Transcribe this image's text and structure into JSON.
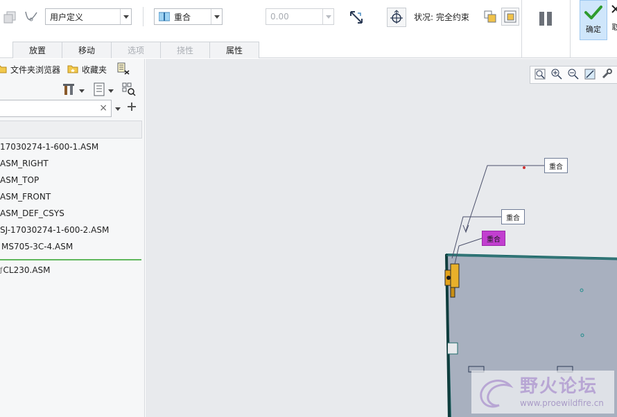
{
  "ribbon": {
    "tabs": [
      {
        "label": "放置"
      },
      {
        "label": "移动"
      },
      {
        "label": "选项"
      },
      {
        "label": "挠性"
      },
      {
        "label": "属性"
      }
    ],
    "constraint_set": {
      "value": "用户定义"
    },
    "constraint_type": {
      "value": "重合"
    },
    "offset": {
      "value": "0.00"
    },
    "status": "状况: 完全约束",
    "ok_label": "确定",
    "cancel_label": "取"
  },
  "left_panel": {
    "header": {
      "folder_browser": "文件夹浏览器",
      "favorites": "收藏夹"
    },
    "search": {
      "value": ""
    },
    "tree": [
      {
        "label": "17030274-1-600-1.ASM"
      },
      {
        "label": "ASM_RIGHT"
      },
      {
        "label": "ASM_TOP"
      },
      {
        "label": "ASM_FRONT"
      },
      {
        "label": "ASM_DEF_CSYS"
      },
      {
        "label": "SJ-17030274-1-600-2.ASM"
      },
      {
        "label": "MS705-3C-4.ASM"
      }
    ],
    "tree_new": [
      {
        "label": "CL230.ASM"
      }
    ]
  },
  "canvas": {
    "callouts": [
      {
        "label": "重合"
      },
      {
        "label": "重合"
      },
      {
        "label": "重合"
      }
    ],
    "watermark": {
      "name": "野火论坛",
      "url": "www.proewildfire.cn"
    }
  },
  "colors": {
    "accent_ok": "#2e9b2e",
    "selection_green": "#5fb85c",
    "callout_active": "#c23fd0",
    "part_fill": "#a8b0bf",
    "part_edge": "#1f6b6b"
  }
}
